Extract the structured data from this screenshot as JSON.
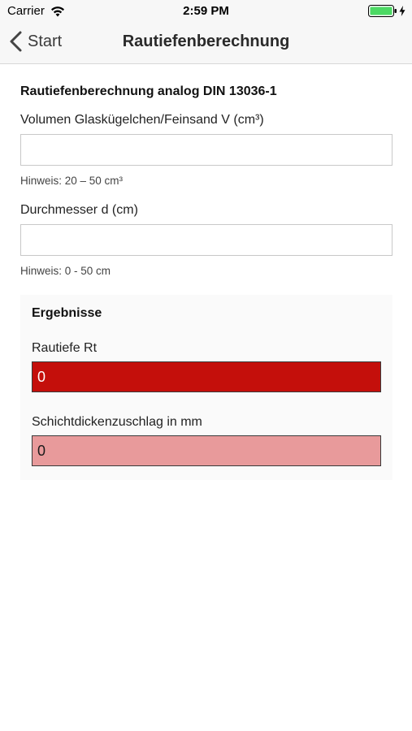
{
  "status_bar": {
    "carrier": "Carrier",
    "time": "2:59 PM",
    "icons": [
      "wifi-icon",
      "battery-icon",
      "charging-bolt-icon"
    ],
    "battery_color": "#4cd964"
  },
  "nav": {
    "back_label": "Start",
    "title": "Rautiefenberechnung"
  },
  "form": {
    "heading": "Rautiefenberechnung analog DIN 13036-1",
    "volumen": {
      "label": "Volumen Glaskügelchen/Feinsand V (cm³)",
      "value": "",
      "hint": "Hinweis: 20 – 50 cm³"
    },
    "durchmesser": {
      "label": "Durchmesser d (cm)",
      "value": "",
      "hint": "Hinweis: 0 - 50 cm"
    }
  },
  "results": {
    "heading": "Ergebnisse",
    "rautiefe": {
      "label": "Rautiefe Rt",
      "value": "0",
      "color": "#c40f0b"
    },
    "schichtdicke": {
      "label": "Schichtdickenzuschlag in mm",
      "value": "0",
      "color": "#e89a9b"
    }
  }
}
